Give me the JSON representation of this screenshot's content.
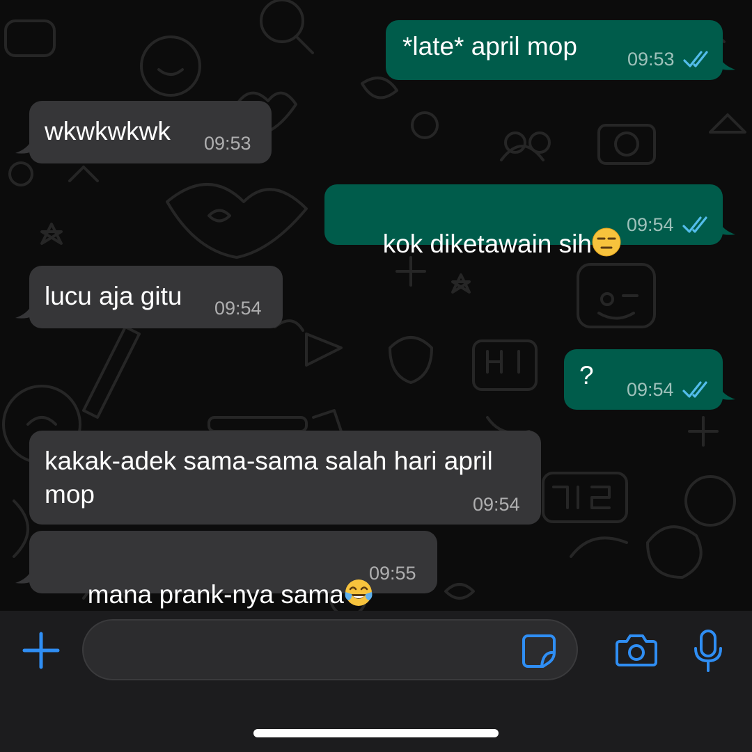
{
  "messages": [
    {
      "direction": "out",
      "text": "*late* april mop",
      "time": "09:53",
      "read": true
    },
    {
      "direction": "in",
      "text": "wkwkwkwk",
      "time": "09:53"
    },
    {
      "direction": "out",
      "text": "kok diketawain sih",
      "emoji": "expressionless-face-emoji",
      "time": "09:54",
      "read": true
    },
    {
      "direction": "in",
      "text": "lucu aja gitu",
      "time": "09:54"
    },
    {
      "direction": "out",
      "text": "?",
      "time": "09:54",
      "read": true
    },
    {
      "direction": "in",
      "text": "kakak-adek sama-sama salah hari april mop",
      "time": "09:54"
    },
    {
      "direction": "in",
      "text": "mana prank-nya sama",
      "emoji": "tears-of-joy-emoji",
      "time": "09:55"
    }
  ],
  "input_bar": {
    "placeholder": "",
    "icons": [
      "plus-icon",
      "sticker-icon",
      "camera-icon",
      "microphone-icon"
    ]
  },
  "colors": {
    "outgoing_bubble": "#005c4b",
    "incoming_bubble": "#363638",
    "accent": "#2f8ef4",
    "read_ticks": "#53bdeb"
  }
}
